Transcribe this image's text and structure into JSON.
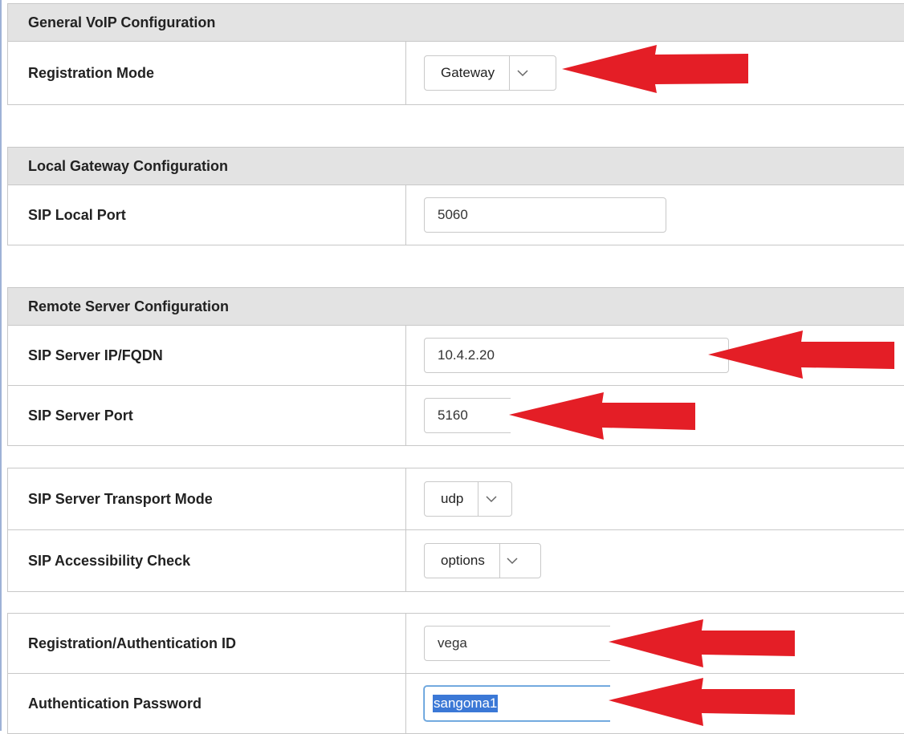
{
  "sections": {
    "general": {
      "title": "General VoIP Configuration",
      "registration_mode": {
        "label": "Registration Mode",
        "value": "Gateway"
      }
    },
    "local": {
      "title": "Local Gateway Configuration",
      "sip_local_port": {
        "label": "SIP Local Port",
        "value": "5060"
      }
    },
    "remote": {
      "title": "Remote Server Configuration",
      "sip_server_ip": {
        "label": "SIP Server IP/FQDN",
        "value": "10.4.2.20"
      },
      "sip_server_port": {
        "label": "SIP Server Port",
        "value": "5160"
      }
    },
    "transport": {
      "transport_mode": {
        "label": "SIP Server Transport Mode",
        "value": "udp"
      },
      "accessibility_check": {
        "label": "SIP Accessibility Check",
        "value": "options"
      }
    },
    "auth": {
      "registration_id": {
        "label": "Registration/Authentication ID",
        "value": "vega"
      },
      "password": {
        "label": "Authentication Password",
        "value": "sangoma1"
      }
    }
  },
  "colors": {
    "header_bg": "#e3e3e3",
    "border": "#c8c8c8",
    "annotation_arrow": "#e41e26",
    "selection": "#3b78d6"
  },
  "icons": {
    "dropdown": "chevron-down-icon",
    "annotation": "red-arrow-icon"
  }
}
